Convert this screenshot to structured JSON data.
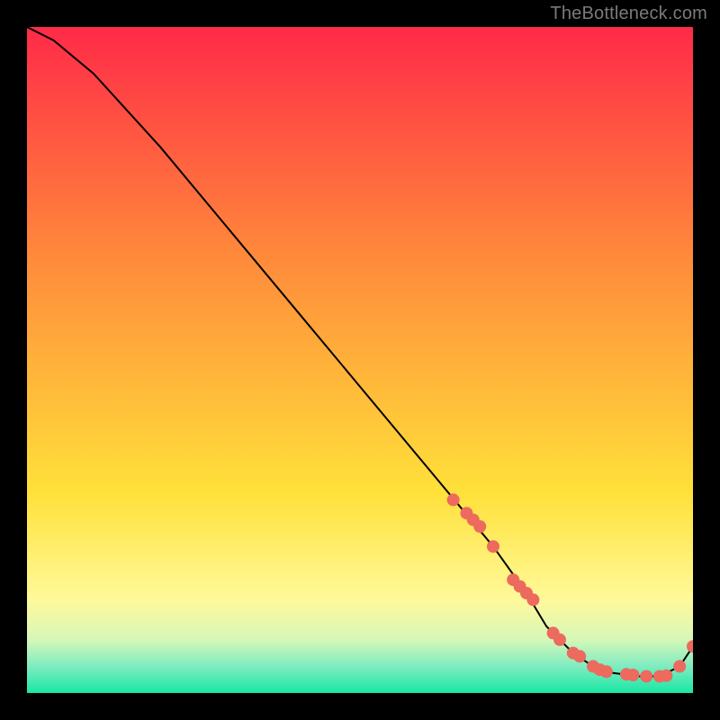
{
  "watermark": "TheBottleneck.com",
  "colors": {
    "background": "#000000",
    "watermark": "#7a7a7a",
    "curve": "#000000",
    "marker": "#ed6a5e",
    "gradient_top": "#ff2a48",
    "gradient_mid1": "#ff8b3a",
    "gradient_mid2": "#ffe13a",
    "gradient_band1": "#fff99a",
    "gradient_band2": "#d6f7b8",
    "gradient_band3": "#7eecc0",
    "gradient_bottom": "#19e7a5"
  },
  "chart_data": {
    "type": "line",
    "title": "",
    "xlabel": "",
    "ylabel": "",
    "xlim": [
      0,
      100
    ],
    "ylim": [
      0,
      100
    ],
    "curve": {
      "x": [
        0,
        4,
        10,
        20,
        30,
        40,
        50,
        60,
        65,
        70,
        75,
        78,
        82,
        85,
        88,
        92,
        95,
        98,
        100
      ],
      "y": [
        100,
        98,
        93,
        82,
        70,
        58,
        46,
        34,
        28,
        22,
        15,
        10,
        6,
        4,
        3,
        2.5,
        2.5,
        4,
        7
      ]
    },
    "markers": {
      "x": [
        64,
        66,
        67,
        68,
        70,
        73,
        74,
        75,
        76,
        79,
        80,
        82,
        83,
        85,
        86,
        87,
        90,
        91,
        93,
        95,
        96,
        98,
        100
      ],
      "y": [
        29,
        27,
        26,
        25,
        22,
        17,
        16,
        15,
        14,
        9,
        8,
        6,
        5.5,
        4,
        3.5,
        3.2,
        2.8,
        2.7,
        2.5,
        2.5,
        2.6,
        4,
        7
      ]
    }
  }
}
